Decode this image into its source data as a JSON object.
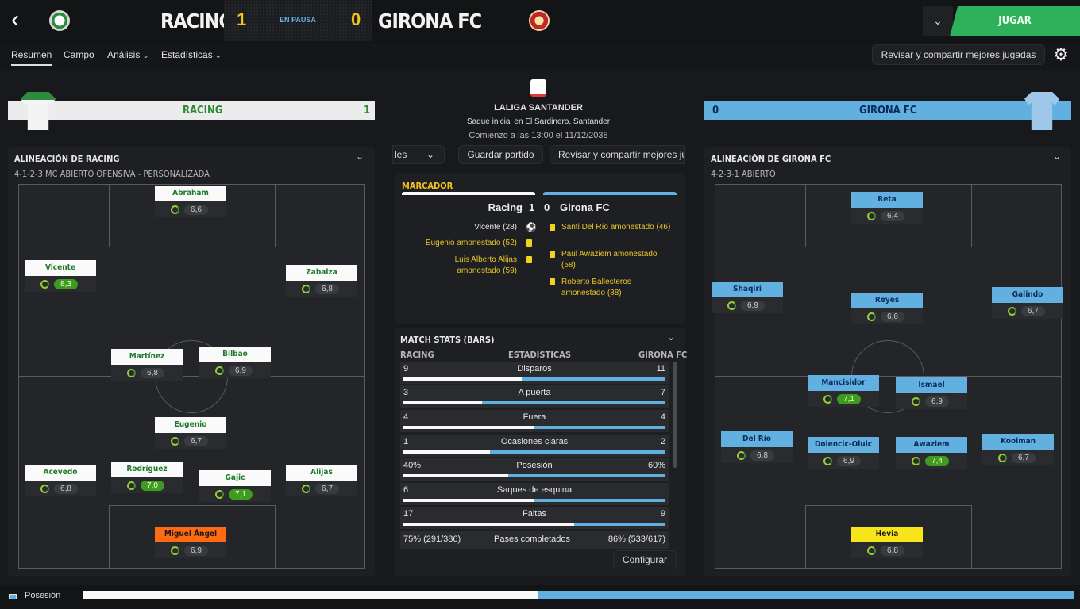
{
  "header": {
    "home_team": "RACING",
    "away_team": "GIRONA FC",
    "home_score": "1",
    "away_score": "0",
    "status": "EN PAUSA",
    "play_label": "JUGAR"
  },
  "nav": {
    "tabs": [
      "Resumen",
      "Campo",
      "Análisis",
      "Estadísticas"
    ],
    "review_btn": "Revisar y compartir mejores jugadas"
  },
  "home": {
    "band_name": "RACING",
    "band_score": "1",
    "lineup_title": "ALINEACIÓN DE RACING",
    "formation": "4-1-2-3 MC ABIERTO OFENSIVA - PERSONALIZADA",
    "players": [
      {
        "name": "Abraham",
        "rating": "6,6",
        "good": false
      },
      {
        "name": "Vicente",
        "rating": "8,3",
        "good": true
      },
      {
        "name": "Zabalza",
        "rating": "6,8",
        "good": false
      },
      {
        "name": "Martínez",
        "rating": "6,8",
        "good": false
      },
      {
        "name": "Bilbao",
        "rating": "6,9",
        "good": false
      },
      {
        "name": "Eugenio",
        "rating": "6,7",
        "good": false
      },
      {
        "name": "Acevedo",
        "rating": "6,8",
        "good": false
      },
      {
        "name": "Rodríguez",
        "rating": "7,0",
        "good": true
      },
      {
        "name": "Gajic",
        "rating": "7,1",
        "good": true
      },
      {
        "name": "Alijas",
        "rating": "6,7",
        "good": false
      },
      {
        "name": "Miguel Ángel",
        "rating": "6,9",
        "good": false
      }
    ]
  },
  "away": {
    "band_name": "GIRONA FC",
    "band_score": "0",
    "lineup_title": "ALINEACIÓN DE GIRONA FC",
    "formation": "4-2-3-1 ABIERTO",
    "players": [
      {
        "name": "Reta",
        "rating": "6,4",
        "good": false
      },
      {
        "name": "Shaqiri",
        "rating": "6,9",
        "good": false
      },
      {
        "name": "Reyes",
        "rating": "6,6",
        "good": false
      },
      {
        "name": "Galindo",
        "rating": "6,7",
        "good": false
      },
      {
        "name": "Mancisidor",
        "rating": "7,1",
        "good": true
      },
      {
        "name": "Ismael",
        "rating": "6,9",
        "good": false
      },
      {
        "name": "Del Río",
        "rating": "6,8",
        "good": false
      },
      {
        "name": "Dolencic-Oluic",
        "rating": "6,9",
        "good": false
      },
      {
        "name": "Awaziem",
        "rating": "7,4",
        "good": true
      },
      {
        "name": "Kooiman",
        "rating": "6,7",
        "good": false
      },
      {
        "name": "Hevia",
        "rating": "6,8",
        "good": false
      }
    ]
  },
  "match": {
    "league": "LALIGA SANTANDER",
    "venue": "Saque inicial en El Sardinero, Santander",
    "kickoff": "Comienzo a las 13:00 el 11/12/2038",
    "left_btn": "les",
    "save_btn": "Guardar partido",
    "review_btn": "Revisar y compartir mejores ju"
  },
  "marcador": {
    "title": "MARCADOR",
    "home": "Racing",
    "home_goals": "1",
    "away_goals": "0",
    "away": "Girona FC",
    "home_events": [
      "Vicente (28)",
      "Eugenio amonestado (52)",
      "Luis Alberto Alijas amonestado (59)"
    ],
    "away_events": [
      "Santi Del Río amonestado (46)",
      "Paul Awaziem amonestado (58)",
      "Roberto Ballesteros amonestado (88)"
    ]
  },
  "stats": {
    "title": "MATCH STATS (BARS)",
    "col_home": "RACING",
    "col_mid": "ESTADÍSTICAS",
    "col_away": "GIRONA FC",
    "configure": "Configurar",
    "rows": [
      {
        "label": "Disparos",
        "home": "9",
        "away": "11",
        "home_frac": 0.45
      },
      {
        "label": "A puerta",
        "home": "3",
        "away": "7",
        "home_frac": 0.3
      },
      {
        "label": "Fuera",
        "home": "4",
        "away": "4",
        "home_frac": 0.5
      },
      {
        "label": "Ocasiones claras",
        "home": "1",
        "away": "2",
        "home_frac": 0.33
      },
      {
        "label": "Posesión",
        "home": "40%",
        "away": "60%",
        "home_frac": 0.4
      },
      {
        "label": "Saques de esquina",
        "home": "6",
        "away": "",
        "home_frac": 0.5
      },
      {
        "label": "Faltas",
        "home": "17",
        "away": "9",
        "home_frac": 0.65
      },
      {
        "label": "Pases completados",
        "home": "75% (291/386)",
        "away": "86% (533/617)",
        "home_frac": 0.47
      }
    ]
  },
  "footer": {
    "possession_label": "Posesión",
    "home_possession": 0.46
  },
  "colors": {
    "home": "#fafafa",
    "away": "#62b0e0",
    "accent": "#2fb15b",
    "highlight": "#f3c41c"
  }
}
